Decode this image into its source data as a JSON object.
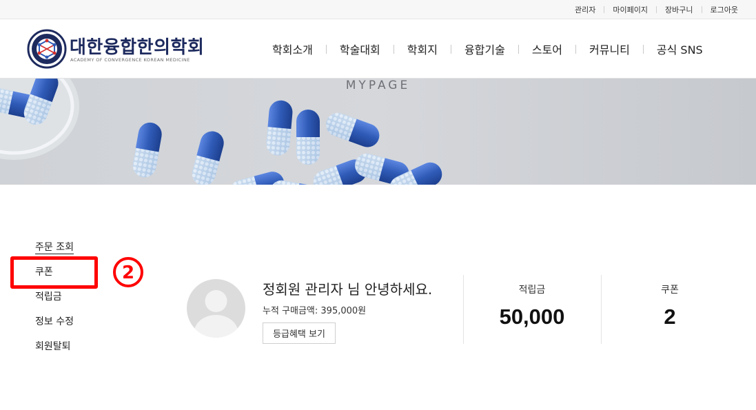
{
  "utility_nav": [
    "관리자",
    "마이페이지",
    "장바구니",
    "로그아웃"
  ],
  "logo": {
    "title": "대한융합한의학회",
    "subtitle": "ACADEMY OF CONVERGENCE KOREAN MEDICINE"
  },
  "main_nav": [
    "학회소개",
    "학술대회",
    "학회지",
    "융합기술",
    "스토어",
    "커뮤니티",
    "공식 SNS"
  ],
  "banner": {
    "title": "MYPAGE"
  },
  "side_menu": [
    "주문 조회",
    "쿠폰",
    "적립금",
    "정보 수정",
    "회원탈퇴"
  ],
  "annotation": {
    "step": "2",
    "color": "#ff0000"
  },
  "profile": {
    "greeting": "정회원 관리자 님 안녕하세요.",
    "total_purchase": "누적 구매금액: 395,000원",
    "grade_button": "등급혜택 보기"
  },
  "stats": [
    {
      "label": "적립금",
      "value": "50,000"
    },
    {
      "label": "쿠폰",
      "value": "2"
    }
  ],
  "colors": {
    "logo_text": "#1d2a5e",
    "capsule_blue": "#2f5bb7",
    "highlight": "#ff0000"
  }
}
